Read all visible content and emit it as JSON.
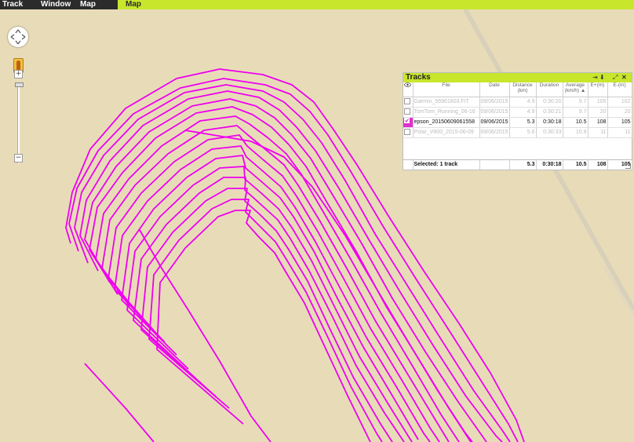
{
  "menu": {
    "items": [
      "Track",
      "Window",
      "Map"
    ],
    "active_tab": "Map"
  },
  "map": {
    "track_color": "#ee00ee",
    "road_color": "#d8d0b8"
  },
  "zoom": {
    "in_label": "+",
    "out_label": "−"
  },
  "tracks_panel": {
    "title": "Tracks",
    "columns": [
      "File",
      "Date",
      "Distance (km)",
      "Duration",
      "Average (km/h) ▲",
      "E+(m)",
      "E-(m)"
    ],
    "rows": [
      {
        "file": "Garmin_56961603.FIT",
        "date": "09/06/2015",
        "distance": "4.9",
        "duration": "0:30:20",
        "average": "9.7",
        "eplus": "105",
        "eminus": "102",
        "checked": false
      },
      {
        "file": "TomTom_Running_06-16",
        "date": "09/06/2015",
        "distance": "4.9",
        "duration": "0:30:21",
        "average": "9.7",
        "eplus": "20",
        "eminus": "20",
        "checked": false
      },
      {
        "file": "epson_20150609061558",
        "date": "09/06/2015",
        "distance": "5.3",
        "duration": "0:30:18",
        "average": "10.5",
        "eplus": "108",
        "eminus": "105",
        "checked": true
      },
      {
        "file": "Polar_V800_2015-06-09",
        "date": "09/06/2015",
        "distance": "5.6",
        "duration": "0:30:33",
        "average": "10.9",
        "eplus": "11",
        "eminus": "11",
        "checked": false
      }
    ],
    "summary": {
      "label": "Selected: 1 track",
      "distance": "5.3",
      "duration": "0:30:18",
      "average": "10.5",
      "eplus": "108",
      "eminus": "105"
    }
  }
}
